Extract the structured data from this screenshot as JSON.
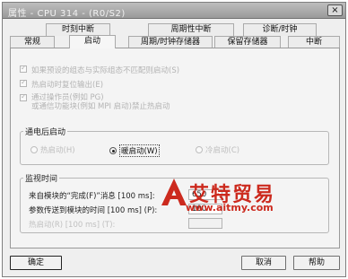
{
  "window": {
    "title": "属性 - CPU 314 - (R0/S2)",
    "close_symbol": "×"
  },
  "tabs": {
    "row_top": [
      {
        "label": "时刻中断"
      },
      {
        "label": "周期性中断"
      },
      {
        "label": "诊断/时钟"
      }
    ],
    "row_bottom": [
      {
        "label": "常规"
      },
      {
        "label": "启动"
      },
      {
        "label": "周期/时钟存储器"
      },
      {
        "label": "保留存储器"
      },
      {
        "label": "中断"
      }
    ],
    "active": "启动"
  },
  "options": [
    {
      "label": "如果预设的组态与实际组态不匹配则启动(S)",
      "checked": true,
      "enabled": false
    },
    {
      "label": "热启动时复位输出(E)",
      "checked": true,
      "enabled": false
    },
    {
      "label": "通过操作员(例如 PG)",
      "label2": "或通信功能块(例如 MPI 启动)禁止热启动",
      "checked": true,
      "enabled": false
    }
  ],
  "startup": {
    "legend": "通电后启动",
    "radios": [
      {
        "label": "热启动(H)",
        "selected": false,
        "enabled": false
      },
      {
        "label": "暖启动(W)",
        "selected": true,
        "enabled": true
      },
      {
        "label": "冷启动(C)",
        "selected": false,
        "enabled": false
      }
    ]
  },
  "monitoring": {
    "legend": "监视时间",
    "fields": [
      {
        "label": "来自模块的“完成(F)”消息 [100 ms]:",
        "value": "650",
        "enabled": true
      },
      {
        "label": "参数传送到模块的时间 [100 ms] (P):",
        "value": "100",
        "enabled": true
      },
      {
        "label": "热启动(R) [100 ms] (T):",
        "value": "",
        "enabled": false
      }
    ]
  },
  "watermark": {
    "cn": "艾特贸易",
    "url": "www.aitmy.com"
  },
  "buttons": {
    "ok": "确定",
    "cancel": "取消",
    "help": "帮助"
  }
}
